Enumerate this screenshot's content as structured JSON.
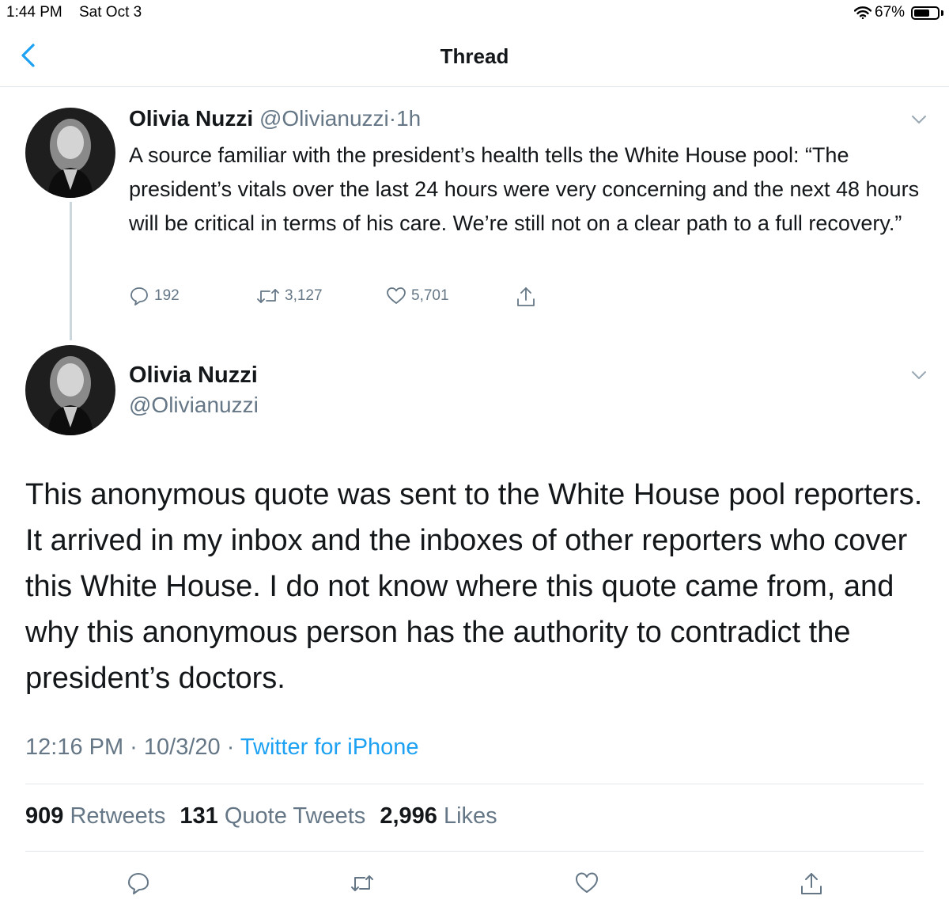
{
  "status_bar": {
    "time": "1:44 PM",
    "date": "Sat Oct 3",
    "battery_percent_label": "67%",
    "battery_level": 0.67
  },
  "nav": {
    "title": "Thread",
    "back_icon": "chevron-left-icon"
  },
  "colors": {
    "accent": "#1da1f2",
    "text_primary": "#14171a",
    "text_secondary": "#657786",
    "divider": "#e1e8ed"
  },
  "tweet1": {
    "name": "Olivia Nuzzi",
    "handle": "@Olivianuzzi",
    "separator": "·",
    "time": "1h",
    "text": "A source familiar with the president’s health tells the White House pool: “The president’s vitals over the last 24 hours were very concerning and the next 48 hours will be critical in terms of his care. We’re still not on a clear path to a full recovery.”",
    "replies": "192",
    "retweets": "3,127",
    "likes": "5,701"
  },
  "tweet2": {
    "name": "Olivia Nuzzi",
    "handle": "@Olivianuzzi",
    "text": "This anonymous quote was sent to the White House pool reporters. It arrived in my inbox and the inboxes of other reporters who cover this White House. I do not know where this quote came from, and why this anonymous person has the authority to contradict the president’s doctors.",
    "timestamp": "12:16 PM · 10/3/20 · ",
    "source": "Twitter for iPhone",
    "retweets_count": "909",
    "retweets_label": "Retweets",
    "quote_count": "131",
    "quote_label": "Quote Tweets",
    "likes_count": "2,996",
    "likes_label": "Likes"
  }
}
